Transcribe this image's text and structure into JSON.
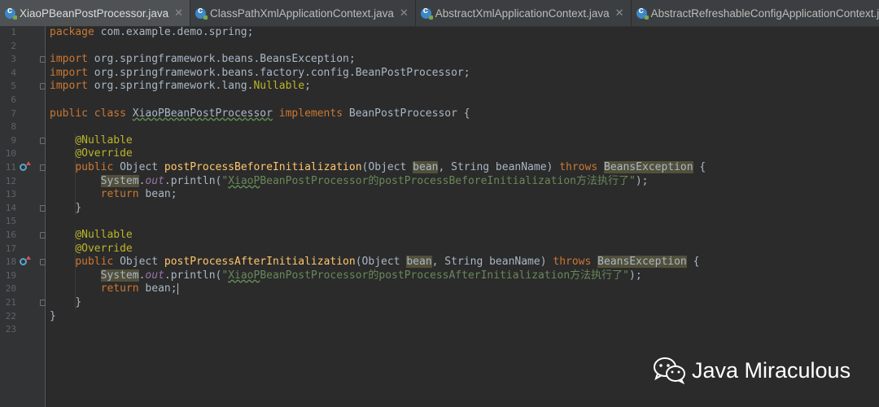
{
  "tabs": [
    {
      "label": "XiaoPBeanPostProcessor.java",
      "active": true
    },
    {
      "label": "ClassPathXmlApplicationContext.java",
      "active": false
    },
    {
      "label": "AbstractXmlApplicationContext.java",
      "active": false
    },
    {
      "label": "AbstractRefreshableConfigApplicationContext.java",
      "active": false
    }
  ],
  "line_numbers": [
    "1",
    "2",
    "3",
    "4",
    "5",
    "6",
    "7",
    "8",
    "9",
    "10",
    "11",
    "12",
    "13",
    "14",
    "15",
    "16",
    "17",
    "18",
    "19",
    "20",
    "21",
    "22",
    "23"
  ],
  "code": {
    "l1": {
      "kw": "package",
      "rest": " com.example.demo.spring;"
    },
    "l3": {
      "kw": "import",
      "rest": " org.springframework.beans.BeansException;"
    },
    "l4": {
      "kw": "import",
      "rest": " org.springframework.beans.factory.config.BeanPostProcessor;"
    },
    "l5": {
      "kw": "import",
      "pre": " org.springframework.lang.",
      "ann": "Nullable",
      "post": ";"
    },
    "l7": {
      "kw": "public class",
      "name": "XiaoPBeanPostProcessor",
      "kw2": "implements",
      "rest": " BeanPostProcessor {"
    },
    "l9": "@Nullable",
    "l10": "@Override",
    "l11": {
      "kw": "public",
      "type": " Object ",
      "fn": "postProcessBeforeInitialization",
      "p1": "(Object ",
      "arg": "bean",
      "p2": ", String beanName) ",
      "kw2": "throws",
      "exc": "BeansException",
      "tail": " {"
    },
    "l12": {
      "sys": "System",
      "dot": ".",
      "out": "out",
      "call": ".println(",
      "str_q1": "\"",
      "str_name": "XiaoP",
      "str_rest": "BeanPostProcessor的postProcessBeforeInitialization方法执行了\"",
      "tail": ");"
    },
    "l13": {
      "kw": "return",
      "rest": " bean;"
    },
    "l14": "}",
    "l16": "@Nullable",
    "l17": "@Override",
    "l18": {
      "kw": "public",
      "type": " Object ",
      "fn": "postProcessAfterInitialization",
      "p1": "(Object ",
      "arg": "bean",
      "p2": ", String beanName) ",
      "kw2": "throws",
      "exc": "BeansException",
      "tail": " {"
    },
    "l19": {
      "sys": "System",
      "dot": ".",
      "out": "out",
      "call": ".println(",
      "str_q1": "\"",
      "str_name": "XiaoP",
      "str_rest": "BeanPostProcessor的postProcessAfterInitialization方法执行了\"",
      "tail": ");"
    },
    "l20": {
      "kw": "return",
      "rest": " bean;"
    },
    "l21": "}",
    "l22": "}"
  },
  "watermark": {
    "text": "Java Miraculous",
    "icon": "wechat-icon"
  },
  "colors": {
    "background": "#2b2b2b",
    "keyword": "#cc7832",
    "annotation": "#bbb529",
    "method": "#ffc66d",
    "string": "#6a8759",
    "field": "#9876aa",
    "text": "#a9b7c6"
  }
}
